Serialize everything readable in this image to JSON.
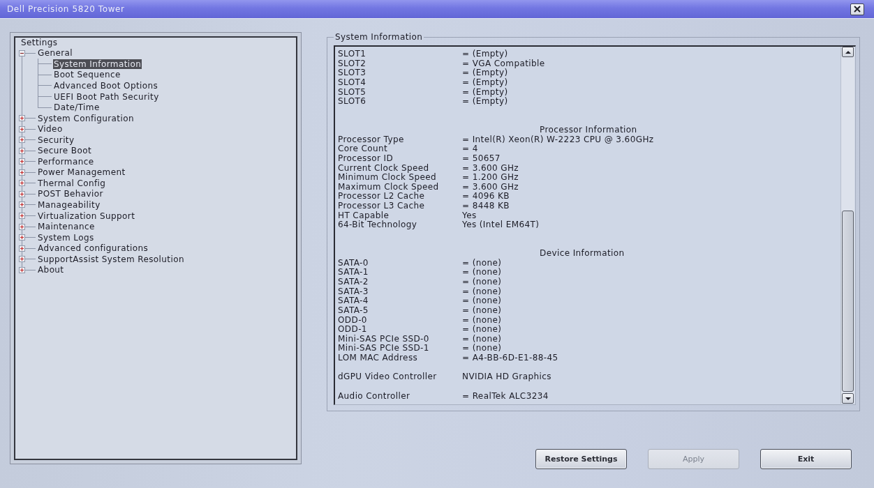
{
  "window": {
    "title": "Dell Precision 5820 Tower"
  },
  "tree": {
    "root": "Settings",
    "items": [
      {
        "label": "General",
        "expanded": true,
        "selected": false,
        "children": [
          {
            "label": "System Information",
            "selected": true
          },
          {
            "label": "Boot Sequence",
            "selected": false
          },
          {
            "label": "Advanced Boot Options",
            "selected": false
          },
          {
            "label": "UEFI Boot Path Security",
            "selected": false
          },
          {
            "label": "Date/Time",
            "selected": false
          }
        ]
      },
      {
        "label": "System Configuration",
        "expanded": false,
        "selected": false
      },
      {
        "label": "Video",
        "expanded": false,
        "selected": false
      },
      {
        "label": "Security",
        "expanded": false,
        "selected": false
      },
      {
        "label": "Secure Boot",
        "expanded": false,
        "selected": false
      },
      {
        "label": "Performance",
        "expanded": false,
        "selected": false
      },
      {
        "label": "Power Management",
        "expanded": false,
        "selected": false
      },
      {
        "label": "Thermal Config",
        "expanded": false,
        "selected": false
      },
      {
        "label": "POST Behavior",
        "expanded": false,
        "selected": false
      },
      {
        "label": "Manageability",
        "expanded": false,
        "selected": false
      },
      {
        "label": "Virtualization Support",
        "expanded": false,
        "selected": false
      },
      {
        "label": "Maintenance",
        "expanded": false,
        "selected": false
      },
      {
        "label": "System Logs",
        "expanded": false,
        "selected": false
      },
      {
        "label": "Advanced configurations",
        "expanded": false,
        "selected": false
      },
      {
        "label": "SupportAssist System Resolution",
        "expanded": false,
        "selected": false
      },
      {
        "label": "About",
        "expanded": false,
        "selected": false
      }
    ]
  },
  "info": {
    "title": "System Information",
    "sections": [
      {
        "rows": [
          {
            "label": "SLOT1",
            "value": "= (Empty)"
          },
          {
            "label": "SLOT2",
            "value": "= VGA Compatible"
          },
          {
            "label": "SLOT3",
            "value": "= (Empty)"
          },
          {
            "label": "SLOT4",
            "value": "= (Empty)"
          },
          {
            "label": "SLOT5",
            "value": "= (Empty)"
          },
          {
            "label": "SLOT6",
            "value": "= (Empty)"
          }
        ]
      },
      {
        "heading": "Processor Information",
        "rows": [
          {
            "label": "Processor Type",
            "value": "= Intel(R) Xeon(R) W-2223 CPU @ 3.60GHz"
          },
          {
            "label": "Core Count",
            "value": "= 4"
          },
          {
            "label": "Processor ID",
            "value": "= 50657"
          },
          {
            "label": "Current Clock Speed",
            "value": "= 3.600 GHz"
          },
          {
            "label": "Minimum Clock Speed",
            "value": "= 1.200 GHz"
          },
          {
            "label": "Maximum Clock Speed",
            "value": "= 3.600 GHz"
          },
          {
            "label": "Processor L2 Cache",
            "value": "= 4096 KB"
          },
          {
            "label": "Processor L3 Cache",
            "value": "= 8448 KB"
          },
          {
            "label": "HT Capable",
            "value": "Yes"
          },
          {
            "label": "64-Bit Technology",
            "value": "Yes (Intel EM64T)"
          }
        ]
      },
      {
        "heading": "Device Information",
        "rows": [
          {
            "label": "SATA-0",
            "value": "= (none)"
          },
          {
            "label": "SATA-1",
            "value": "= (none)"
          },
          {
            "label": "SATA-2",
            "value": "= (none)"
          },
          {
            "label": "SATA-3",
            "value": "= (none)"
          },
          {
            "label": "SATA-4",
            "value": "= (none)"
          },
          {
            "label": "SATA-5",
            "value": "= (none)"
          },
          {
            "label": "ODD-0",
            "value": "= (none)"
          },
          {
            "label": "ODD-1",
            "value": "= (none)"
          },
          {
            "label": "Mini-SAS PCIe SSD-0",
            "value": "= (none)"
          },
          {
            "label": "Mini-SAS PCIe SSD-1",
            "value": "= (none)"
          },
          {
            "label": "LOM MAC Address",
            "value": "= A4-BB-6D-E1-88-45"
          }
        ]
      },
      {
        "rows": [
          {
            "label": "dGPU Video Controller",
            "value": "NVIDIA HD Graphics"
          }
        ]
      },
      {
        "rows": [
          {
            "label": "Audio Controller",
            "value": "= RealTek ALC3234"
          }
        ]
      }
    ]
  },
  "buttons": [
    {
      "label": "Restore Settings",
      "disabled": false
    },
    {
      "label": "Apply",
      "disabled": true
    },
    {
      "label": "Exit",
      "disabled": false
    }
  ]
}
